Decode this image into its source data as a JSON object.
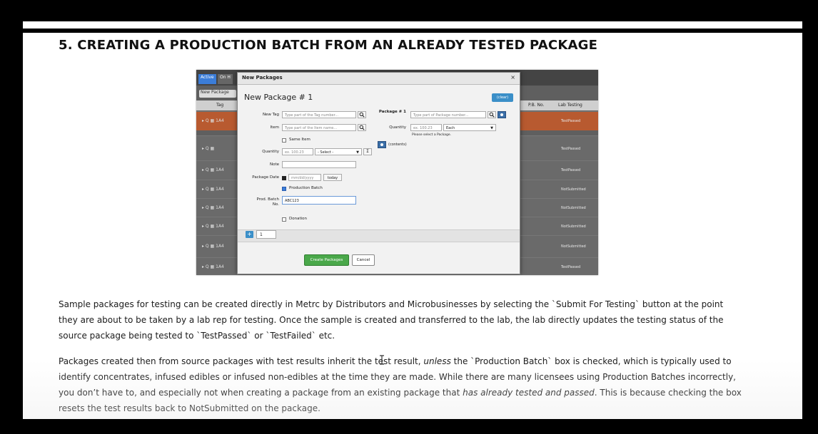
{
  "document": {
    "heading": "5. CREATING A PRODUCTION BATCH FROM AN ALREADY TESTED PACKAGE",
    "paragraph1": "Sample packages for testing can be created directly in Metrc by Distributors and Microbusinesses by selecting the `Submit For Testing` button at the point they are about to be taken by a lab rep for testing. Once the sample is created and transferred to the lab, the lab directly updates the testing status of the source package being tested to `TestPassed` or `TestFailed` etc.",
    "paragraph2": {
      "part1": "Packages created then from source packages with test results inherit the test result, ",
      "unless": "unless",
      "part2": " the `Production Batch` box is checked, which is typically used to identify concentrates, infused edibles or infused non-edibles at the time they are made. While there are many licensees using Production Batches incorrectly, you don’t have to, and especially not when creating a package from an existing package that ",
      "italic_end": "has already tested and passed",
      "part3": ". This is because checking the box resets the test results back to NotSubmitted on the package."
    }
  },
  "screenshot": {
    "background": {
      "tabs": [
        "Active",
        "On H"
      ],
      "new_package_button": "New Package",
      "headers": {
        "tag": "Tag",
        "pb_no": "P.B. No.",
        "lab_testing": "Lab Testing"
      },
      "rows": [
        {
          "lead": "▸  Q ▦  1A4",
          "status": "TestPassed",
          "highlight": true
        },
        {
          "lead": "▸  Q ▦",
          "status": "TestPassed",
          "highlight": false
        },
        {
          "lead": "▸  Q ▦  1A4",
          "status": "TestPassed",
          "highlight": false
        },
        {
          "lead": "▸  Q ▦  1A4",
          "status": "NotSubmitted",
          "highlight": false
        },
        {
          "lead": "▸  Q ▦  1A4",
          "status": "NotSubmitted",
          "highlight": false
        },
        {
          "lead": "▸  Q ▦  1A4",
          "status": "NotSubmitted",
          "highlight": false
        },
        {
          "lead": "▸  Q ▦  1A4",
          "status": "NotSubmitted",
          "highlight": false
        },
        {
          "lead": "▸  Q ▦  1A4",
          "status": "TestPassed",
          "highlight": false
        }
      ]
    },
    "modal": {
      "title": "New Packages",
      "close": "×",
      "package_title": "New Package # 1",
      "clear_button": "(clear)",
      "left": {
        "new_tag_label": "New Tag",
        "new_tag_placeholder": "Type part of the Tag number...",
        "item_label": "Item",
        "item_placeholder": "Type part of the Item name...",
        "same_item": "Same Item",
        "quantity_label": "Quantity",
        "quantity_placeholder": "ex. 100.23",
        "quantity_select": "- Select -",
        "sigma": "Σ",
        "note_label": "Note",
        "package_date_label": "Package Date",
        "package_date_placeholder": "mm/dd/yyyy",
        "today_button": "today",
        "production_batch": "Production Batch",
        "prod_batch_label_1": "Prod. Batch",
        "prod_batch_label_2": "No.",
        "prod_batch_value": "ABC123",
        "donation": "Donation"
      },
      "right": {
        "package_label": "Package # 1",
        "package_placeholder": "Type part of Package number...",
        "quantity_label": "Quantity",
        "quantity_placeholder": "ex. 100.23",
        "unit": "Each",
        "hint": "Please select a Package.",
        "contents": "(contents)"
      },
      "count": "1",
      "plus": "+",
      "create_button": "Create Packages",
      "cancel_button": "Cancel"
    }
  }
}
